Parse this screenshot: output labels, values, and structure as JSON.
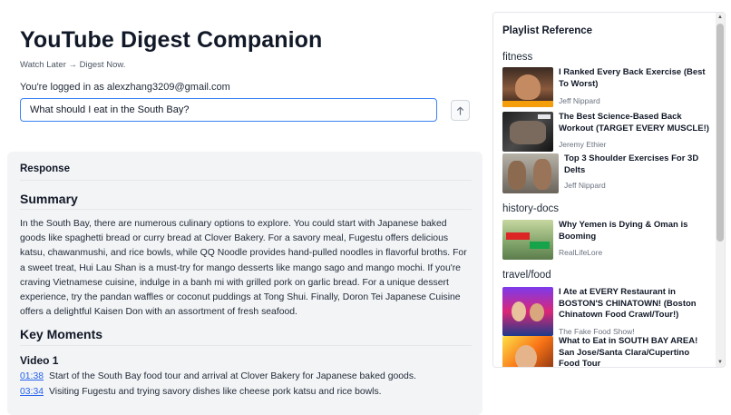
{
  "header": {
    "title": "YouTube Digest Companion",
    "tagline": "Watch Later → Digest Now.",
    "logged_in": "You're logged in as alexzhang3209@gmail.com"
  },
  "query": {
    "value": "What should I eat in the South Bay?",
    "submit_icon": "arrow-up-icon"
  },
  "response": {
    "heading": "Response",
    "summary_heading": "Summary",
    "summary_text": "In the South Bay, there are numerous culinary options to explore. You could start with Japanese baked goods like spaghetti bread or curry bread at Clover Bakery. For a savory meal, Fugestu offers delicious katsu, chawanmushi, and rice bowls, while QQ Noodle provides hand-pulled noodles in flavorful broths. For a sweet treat, Hui Lau Shan is a must-try for mango desserts like mango sago and mango mochi. If you're craving Vietnamese cuisine, indulge in a banh mi with grilled pork on garlic bread. For a unique dessert experience, try the pandan waffles or coconut puddings at Tong Shui. Finally, Doron Tei Japanese Cuisine offers a delightful Kaisen Don with an assortment of fresh seafood.",
    "key_moments_heading": "Key Moments",
    "video_heading": "Video 1",
    "moments": [
      {
        "time": "01:38",
        "text": "Start of the South Bay food tour and arrival at Clover Bakery for Japanese baked goods."
      },
      {
        "time": "03:34",
        "text": "Visiting Fugestu and trying savory dishes like cheese pork katsu and rice bowls."
      }
    ]
  },
  "playlist": {
    "title": "Playlist Reference",
    "categories": [
      {
        "name": "fitness",
        "videos": [
          {
            "title": "I Ranked Every Back Exercise (Best To Worst)",
            "channel": "Jeff Nippard"
          },
          {
            "title": "The Best Science-Based Back Workout (TARGET EVERY MUSCLE!)",
            "channel": "Jeremy Ethier"
          },
          {
            "title": "Top 3 Shoulder Exercises For 3D Delts",
            "channel": "Jeff Nippard"
          }
        ]
      },
      {
        "name": "history-docs",
        "videos": [
          {
            "title": "Why Yemen is Dying & Oman is Booming",
            "channel": "RealLifeLore"
          }
        ]
      },
      {
        "name": "travel/food",
        "videos": [
          {
            "title": "I Ate at EVERY Restaurant in BOSTON'S CHINATOWN! (Boston Chinatown Food Crawl/Tour!)",
            "channel": "The Fake Food Show!"
          },
          {
            "title": "What to Eat in SOUTH BAY AREA! San Jose/Santa Clara/Cupertino Food Tour",
            "channel": ""
          }
        ]
      }
    ]
  },
  "colors": {
    "accent": "#3b82f6",
    "link": "#2563eb",
    "panel_bg": "#f3f4f6"
  }
}
